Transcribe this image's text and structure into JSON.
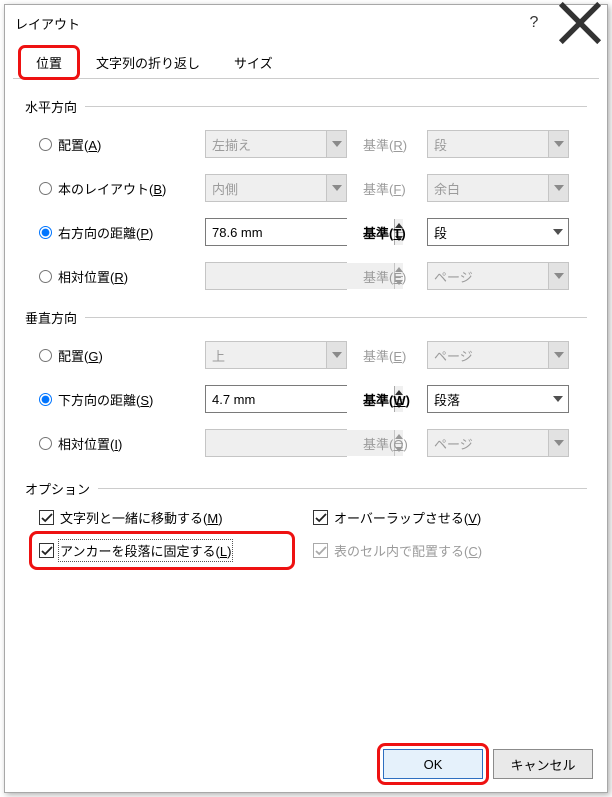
{
  "window_title": "レイアウト",
  "titlebar": {
    "help_tip": "ヘルプ",
    "close_tip": "閉じる"
  },
  "tabs": [
    {
      "label": "位置",
      "active": true
    },
    {
      "label": "文字列の折り返し",
      "active": false
    },
    {
      "label": "サイズ",
      "active": false
    }
  ],
  "horizontal": {
    "label": "水平方向",
    "rows": [
      {
        "kind": "align",
        "radio": "配置",
        "key": "A",
        "value": "左揃え",
        "ref": "基準",
        "refkey": "R",
        "ref_value": "段",
        "value_enabled": false,
        "ref_enabled": false
      },
      {
        "kind": "book",
        "radio": "本のレイアウト",
        "key": "B",
        "value": "内側",
        "ref": "基準",
        "refkey": "F",
        "ref_value": "余白",
        "value_enabled": false,
        "ref_enabled": false
      },
      {
        "kind": "absr",
        "radio": "右方向の距離",
        "key": "P",
        "value": "78.6 mm",
        "ref": "基準",
        "refkey": "T",
        "ref_value": "段",
        "value_enabled": true,
        "ref_enabled": true,
        "checked": true,
        "bold_ref": true
      },
      {
        "kind": "rel",
        "radio": "相対位置",
        "key": "R",
        "value": "",
        "ref": "基準",
        "refkey": "E",
        "ref_value": "ページ",
        "value_enabled": false,
        "ref_enabled": false
      }
    ]
  },
  "vertical": {
    "label": "垂直方向",
    "rows": [
      {
        "kind": "align",
        "radio": "配置",
        "key": "G",
        "value": "上",
        "ref": "基準",
        "refkey": "E",
        "ref_value": "ページ",
        "value_enabled": false,
        "ref_enabled": false
      },
      {
        "kind": "absd",
        "radio": "下方向の距離",
        "key": "S",
        "value": "4.7 mm",
        "ref": "基準",
        "refkey": "W",
        "ref_value": "段落",
        "value_enabled": true,
        "ref_enabled": true,
        "checked": true,
        "bold_ref": true
      },
      {
        "kind": "rel",
        "radio": "相対位置",
        "key": "I",
        "value": "",
        "ref": "基準",
        "refkey": "O",
        "ref_value": "ページ",
        "value_enabled": false,
        "ref_enabled": false
      }
    ]
  },
  "options": {
    "label": "オプション",
    "items": [
      {
        "label": "文字列と一緒に移動する",
        "key": "M",
        "checked": true,
        "enabled": true
      },
      {
        "label": "オーバーラップさせる",
        "key": "V",
        "checked": true,
        "enabled": true
      },
      {
        "label": "アンカーを段落に固定する",
        "key": "L",
        "checked": true,
        "enabled": true,
        "highlight": true,
        "dotted": true
      },
      {
        "label": "表のセル内で配置する",
        "key": "C",
        "checked": true,
        "enabled": false
      }
    ]
  },
  "footer": {
    "ok": "OK",
    "cancel": "キャンセル"
  }
}
